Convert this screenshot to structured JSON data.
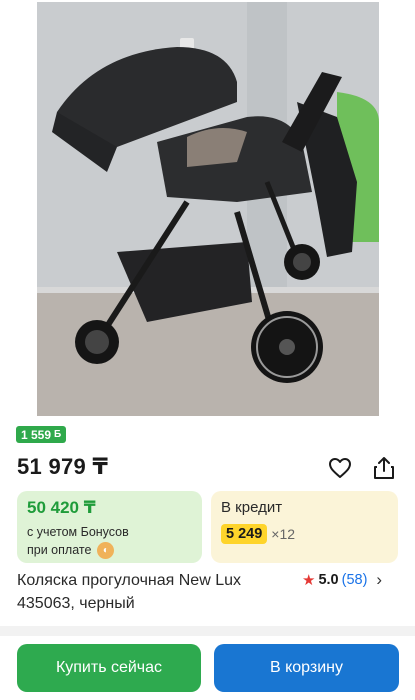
{
  "product": {
    "image_alt": "stroller photo",
    "bonus_badge": "1 559",
    "bonus_symbol": "Б",
    "price": "51 979 ₸",
    "title_line1": "Коляска прогулочная New Lux",
    "title_line2": "435063, черный",
    "rating_value": "5.0",
    "rating_count": "(58)"
  },
  "bonus_card": {
    "price": "50 420 ₸",
    "note_line1": "с учетом Бонусов",
    "note_line2": "при оплате"
  },
  "credit_card": {
    "title": "В кредит",
    "amount": "5 249",
    "months": "×12"
  },
  "actions": {
    "buy_now": "Купить сейчас",
    "to_cart": "В корзину"
  },
  "icons": {
    "favorite": "heart-icon",
    "share": "share-icon",
    "star": "star-icon",
    "chevron": "chevron-right-icon"
  },
  "colors": {
    "green": "#2eaa4f",
    "blue": "#1976d2",
    "bonus_bg": "#dff3d6",
    "credit_bg": "#fbf4d8",
    "credit_highlight": "#fed42b",
    "star": "#e53935"
  }
}
